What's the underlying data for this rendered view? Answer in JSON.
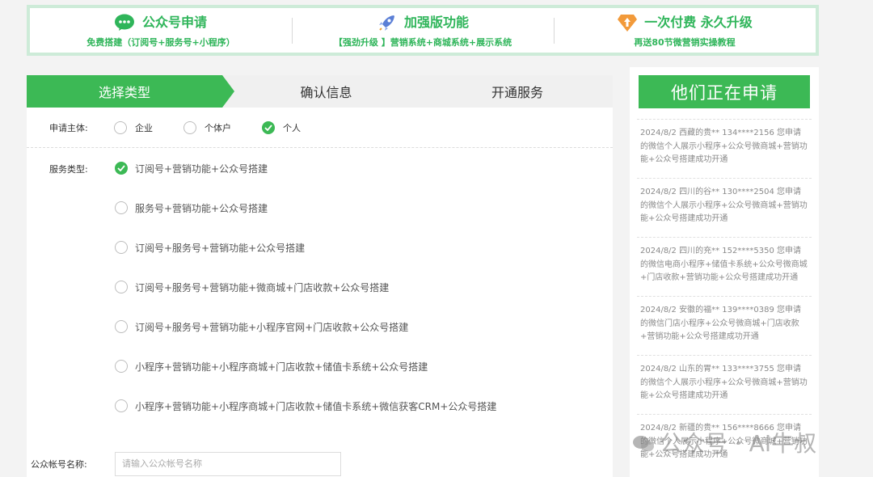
{
  "banner": [
    {
      "title": "公众号申请",
      "sub": "免费搭建（订阅号+服务号+小程序）",
      "icon": "wechat-icon"
    },
    {
      "title": "加强版功能",
      "sub": "【强劲升级 】营销系统+商城系统+展示系统",
      "icon": "rocket-icon"
    },
    {
      "title": "一次付费 永久升级",
      "sub": "再送80节微营销实操教程",
      "icon": "upgrade-arrow-icon"
    }
  ],
  "steps": [
    "选择类型",
    "确认信息",
    "开通服务"
  ],
  "subject": {
    "label": "申请主体:",
    "options": [
      "企业",
      "个体户",
      "个人"
    ],
    "selected": "个人"
  },
  "service": {
    "label": "服务类型:",
    "options": [
      "订阅号+营销功能+公众号搭建",
      "服务号+营销功能+公众号搭建",
      "订阅号+服务号+营销功能+公众号搭建",
      "订阅号+服务号+营销功能+微商城+门店收款+公众号搭建",
      "订阅号+服务号+营销功能+小程序官网+门店收款+公众号搭建",
      "小程序+营销功能+小程序商城+门店收款+储值卡系统+公众号搭建",
      "小程序+营销功能+小程序商城+门店收款+储值卡系统+微信获客CRM+公众号搭建"
    ],
    "selected_index": 0
  },
  "account": {
    "label": "公众帐号名称:",
    "placeholder": "请输入公众帐号名称"
  },
  "side": {
    "title": "他们正在申请",
    "items": [
      "2024/8/2 西藏的贵** 134****2156 您申请的微信个人展示小程序+公众号微商城+营销功能+公众号搭建成功开通",
      "2024/8/2 四川的谷** 130****2504 您申请的微信个人展示小程序+公众号微商城+营销功能+公众号搭建成功开通",
      "2024/8/2 四川的充** 152****5350 您申请的微信电商小程序+储值卡系统+公众号微商城+门店收款+营销功能+公众号搭建成功开通",
      "2024/8/2 安徽的福** 139****0389 您申请的微信门店小程序+公众号微商城+门店收款+营销功能+公众号搭建成功开通",
      "2024/8/2 山东的胃** 133****3755 您申请的微信个人展示小程序+公众号微商城+营销功能+公众号搭建成功开通",
      "2024/8/2 新疆的贵** 156****8666 您申请的微信个人展示小程序+公众号微商城+营销功能+公众号搭建成功开通"
    ]
  },
  "watermark": "公众号 · AI牛叔",
  "colors": {
    "accent": "#3cb955",
    "banner_border": "#cdebd8"
  }
}
